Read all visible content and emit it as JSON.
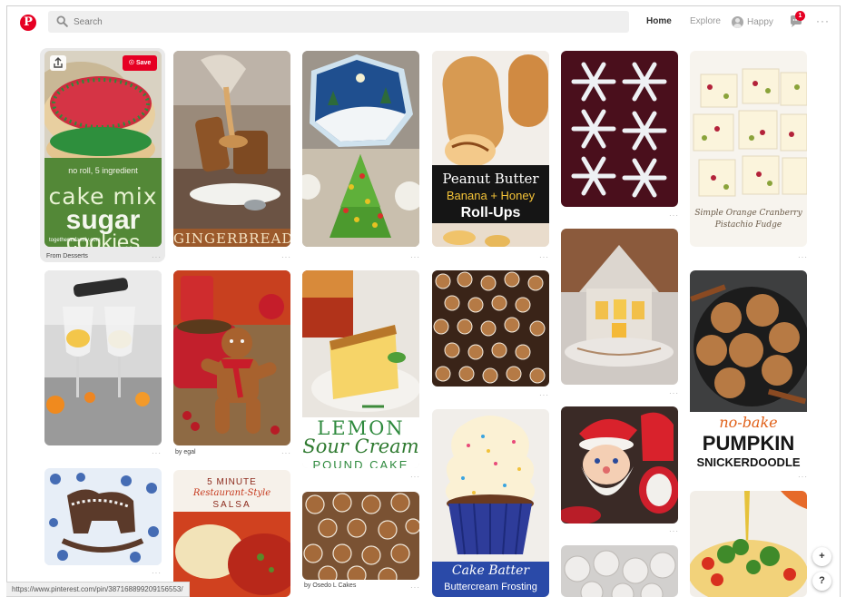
{
  "header": {
    "logo_letter": "P",
    "search_placeholder": "Search",
    "nav_home": "Home",
    "nav_explore": "Explore",
    "user_name": "Happy",
    "notification_count": "1",
    "more": "···",
    "brand_color": "#e60023"
  },
  "pins": {
    "p1": {
      "line1": "no roll, 5 ingredient",
      "line2": "cake mix",
      "line3": "sugar",
      "line4": "cookies",
      "site": "togetherasfamily.com",
      "save": "Save",
      "board": "From Desserts"
    },
    "p2": {
      "caption": "GINGERBREAD"
    },
    "p4": {
      "line1": "Peanut Butter",
      "line2": "Banana + Honey",
      "line3": "Roll-Ups"
    },
    "p6": {
      "line1": "Simple Orange Cranberry",
      "line2": "Pistachio Fudge"
    },
    "p8": {
      "author": "by egal"
    },
    "p9": {
      "line1": "LEMON",
      "line2": "Sour Cream",
      "line3": "POUND CAKE"
    },
    "p11": {
      "line1": "Cake Batter",
      "line2": "Buttercream Frosting"
    },
    "p12": {
      "line1": "no-bake",
      "line2": "PUMPKIN",
      "line3": "SNICKERDOODLE"
    },
    "p15": {
      "line1": "5 MINUTE",
      "line2": "Restaurant-Style",
      "line3": "SALSA"
    },
    "p16": {
      "author": "by Osedo L Cakes"
    },
    "dots": "···"
  },
  "fab": {
    "plus": "+",
    "help": "?"
  },
  "status_url": "https://www.pinterest.com/pin/387168899209156553/"
}
